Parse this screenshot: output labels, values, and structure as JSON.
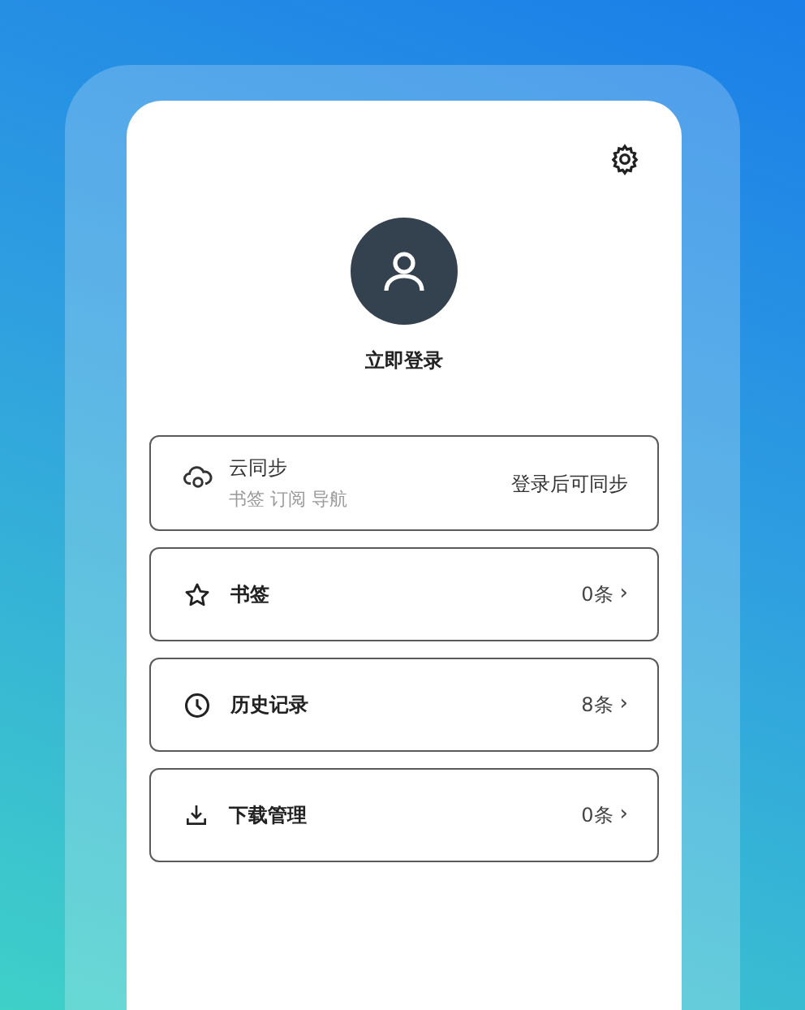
{
  "profile": {
    "login_label": "立即登录"
  },
  "cloud_sync": {
    "kind": "sync",
    "title": "云同步",
    "subtitle": "书签 订阅 导航",
    "status": "登录后可同步"
  },
  "entries": [
    {
      "kind": "entry",
      "label": "书签",
      "count": "0条",
      "chevron": "›"
    },
    {
      "kind": "entry",
      "label": "历史记录",
      "count": "8条",
      "chevron": "›"
    },
    {
      "kind": "entry",
      "label": "下载管理",
      "count": "0条",
      "chevron": "›"
    }
  ]
}
